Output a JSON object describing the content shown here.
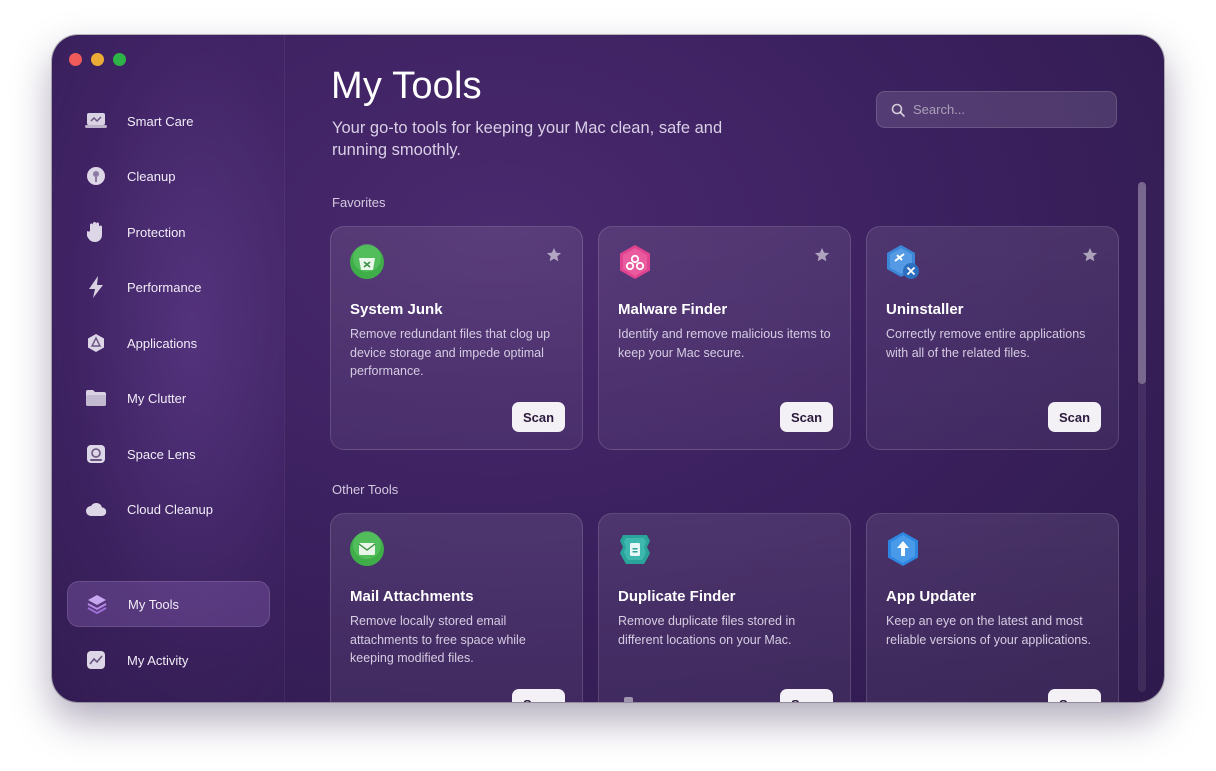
{
  "sidebar": {
    "items": [
      {
        "label": "Smart Care",
        "icon": "smart-care-icon"
      },
      {
        "label": "Cleanup",
        "icon": "cleanup-icon"
      },
      {
        "label": "Protection",
        "icon": "protection-hand-icon"
      },
      {
        "label": "Performance",
        "icon": "performance-bolt-icon"
      },
      {
        "label": "Applications",
        "icon": "applications-icon"
      },
      {
        "label": "My Clutter",
        "icon": "my-clutter-folder-icon"
      },
      {
        "label": "Space Lens",
        "icon": "space-lens-icon"
      },
      {
        "label": "Cloud Cleanup",
        "icon": "cloud-cleanup-icon"
      }
    ],
    "bottom": [
      {
        "label": "My Tools",
        "icon": "my-tools-stack-icon",
        "active": true
      },
      {
        "label": "My Activity",
        "icon": "my-activity-chart-icon"
      }
    ]
  },
  "main": {
    "title": "My Tools",
    "subtitle": "Your go-to tools for keeping your Mac clean, safe and running smoothly.",
    "search": {
      "placeholder": "Search..."
    },
    "favorites_label": "Favorites",
    "other_label": "Other Tools",
    "favorites": [
      {
        "title": "System Junk",
        "desc": "Remove redundant files that clog up device storage and impede optimal performance.",
        "button": "Scan",
        "icon": "system-junk-icon",
        "color": "#3fae49"
      },
      {
        "title": "Malware Finder",
        "desc": "Identify and remove malicious items to keep your Mac secure.",
        "button": "Scan",
        "icon": "malware-finder-icon",
        "color": "#e0438f"
      },
      {
        "title": "Uninstaller",
        "desc": "Correctly remove entire applications with all of the related files.",
        "button": "Scan",
        "icon": "uninstaller-icon",
        "color": "#3b86d6"
      }
    ],
    "other": [
      {
        "title": "Mail Attachments",
        "desc": "Remove locally stored email attachments to free space while keeping modified files.",
        "button": "Scan",
        "icon": "mail-attachments-icon",
        "color": "#3fae49"
      },
      {
        "title": "Duplicate Finder",
        "desc": "Remove duplicate files stored in different locations on your Mac.",
        "button": "Scan",
        "icon": "duplicate-finder-icon",
        "color": "#2aa39a"
      },
      {
        "title": "App Updater",
        "desc": "Keep an eye on the latest and most reliable versions of your applications.",
        "button": "Scan",
        "icon": "app-updater-icon",
        "color": "#2f86e0"
      }
    ]
  }
}
